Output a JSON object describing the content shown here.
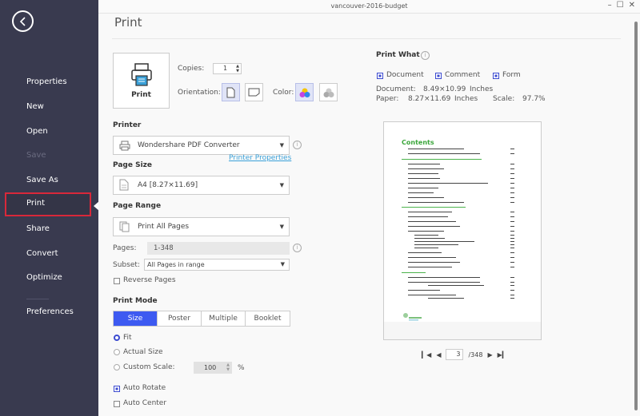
{
  "window": {
    "title": "vancouver-2016-budget",
    "controls": [
      "minimize",
      "maximize",
      "close"
    ]
  },
  "sidebar": {
    "items": [
      {
        "label": "Properties",
        "state": "normal"
      },
      {
        "label": "New",
        "state": "normal"
      },
      {
        "label": "Open",
        "state": "normal"
      },
      {
        "label": "Save",
        "state": "disabled"
      },
      {
        "label": "Save As",
        "state": "normal"
      },
      {
        "label": "Print",
        "state": "active"
      },
      {
        "label": "Share",
        "state": "normal"
      },
      {
        "label": "Convert",
        "state": "normal"
      },
      {
        "label": "Optimize",
        "state": "normal"
      },
      {
        "label": "Preferences",
        "state": "normal"
      }
    ]
  },
  "page": {
    "title": "Print"
  },
  "print_button": {
    "label": "Print"
  },
  "copies": {
    "label": "Copies:",
    "value": "1"
  },
  "orientation": {
    "label": "Orientation:",
    "options": [
      "portrait",
      "landscape"
    ],
    "selected": "portrait"
  },
  "color": {
    "label": "Color:",
    "options": [
      "color",
      "grayscale"
    ],
    "selected": "color"
  },
  "printer": {
    "heading": "Printer",
    "selected": "Wondershare PDF Converter",
    "properties_link": "Printer Properties"
  },
  "page_size": {
    "heading": "Page Size",
    "selected": "A4 [8.27×11.69]"
  },
  "page_range": {
    "heading": "Page Range",
    "selected": "Print All Pages",
    "pages_label": "Pages:",
    "pages_value": "1-348",
    "subset_label": "Subset:",
    "subset_value": "All Pages in range",
    "reverse_label": "Reverse Pages",
    "reverse_checked": false
  },
  "print_mode": {
    "heading": "Print Mode",
    "tabs": [
      "Size",
      "Poster",
      "Multiple",
      "Booklet"
    ],
    "active_tab": "Size",
    "fit_label": "Fit",
    "actual_label": "Actual Size",
    "custom_label": "Custom Scale:",
    "selected_scale_option": "Fit",
    "custom_scale_value": "100",
    "percent": "%",
    "auto_rotate_label": "Auto Rotate",
    "auto_rotate_checked": true,
    "auto_center_label": "Auto Center",
    "auto_center_checked": false
  },
  "print_what": {
    "heading": "Print What",
    "options": [
      {
        "label": "Document",
        "checked": true
      },
      {
        "label": "Comment",
        "checked": true
      },
      {
        "label": "Form",
        "checked": true
      }
    ],
    "document_label": "Document:",
    "document_size": "8.49×10.99",
    "document_units": "Inches",
    "paper_label": "Paper:",
    "paper_size": "8.27×11.69",
    "paper_units": "Inches",
    "scale_label": "Scale:",
    "scale_value": "97.7%"
  },
  "preview": {
    "heading": "Contents",
    "current_page": "3",
    "total_pages": "/348"
  },
  "colors": {
    "accent": "#3d5af1",
    "sidebar": "#393a4f",
    "active_outline": "#d9283a",
    "link": "#3aa0d8"
  }
}
